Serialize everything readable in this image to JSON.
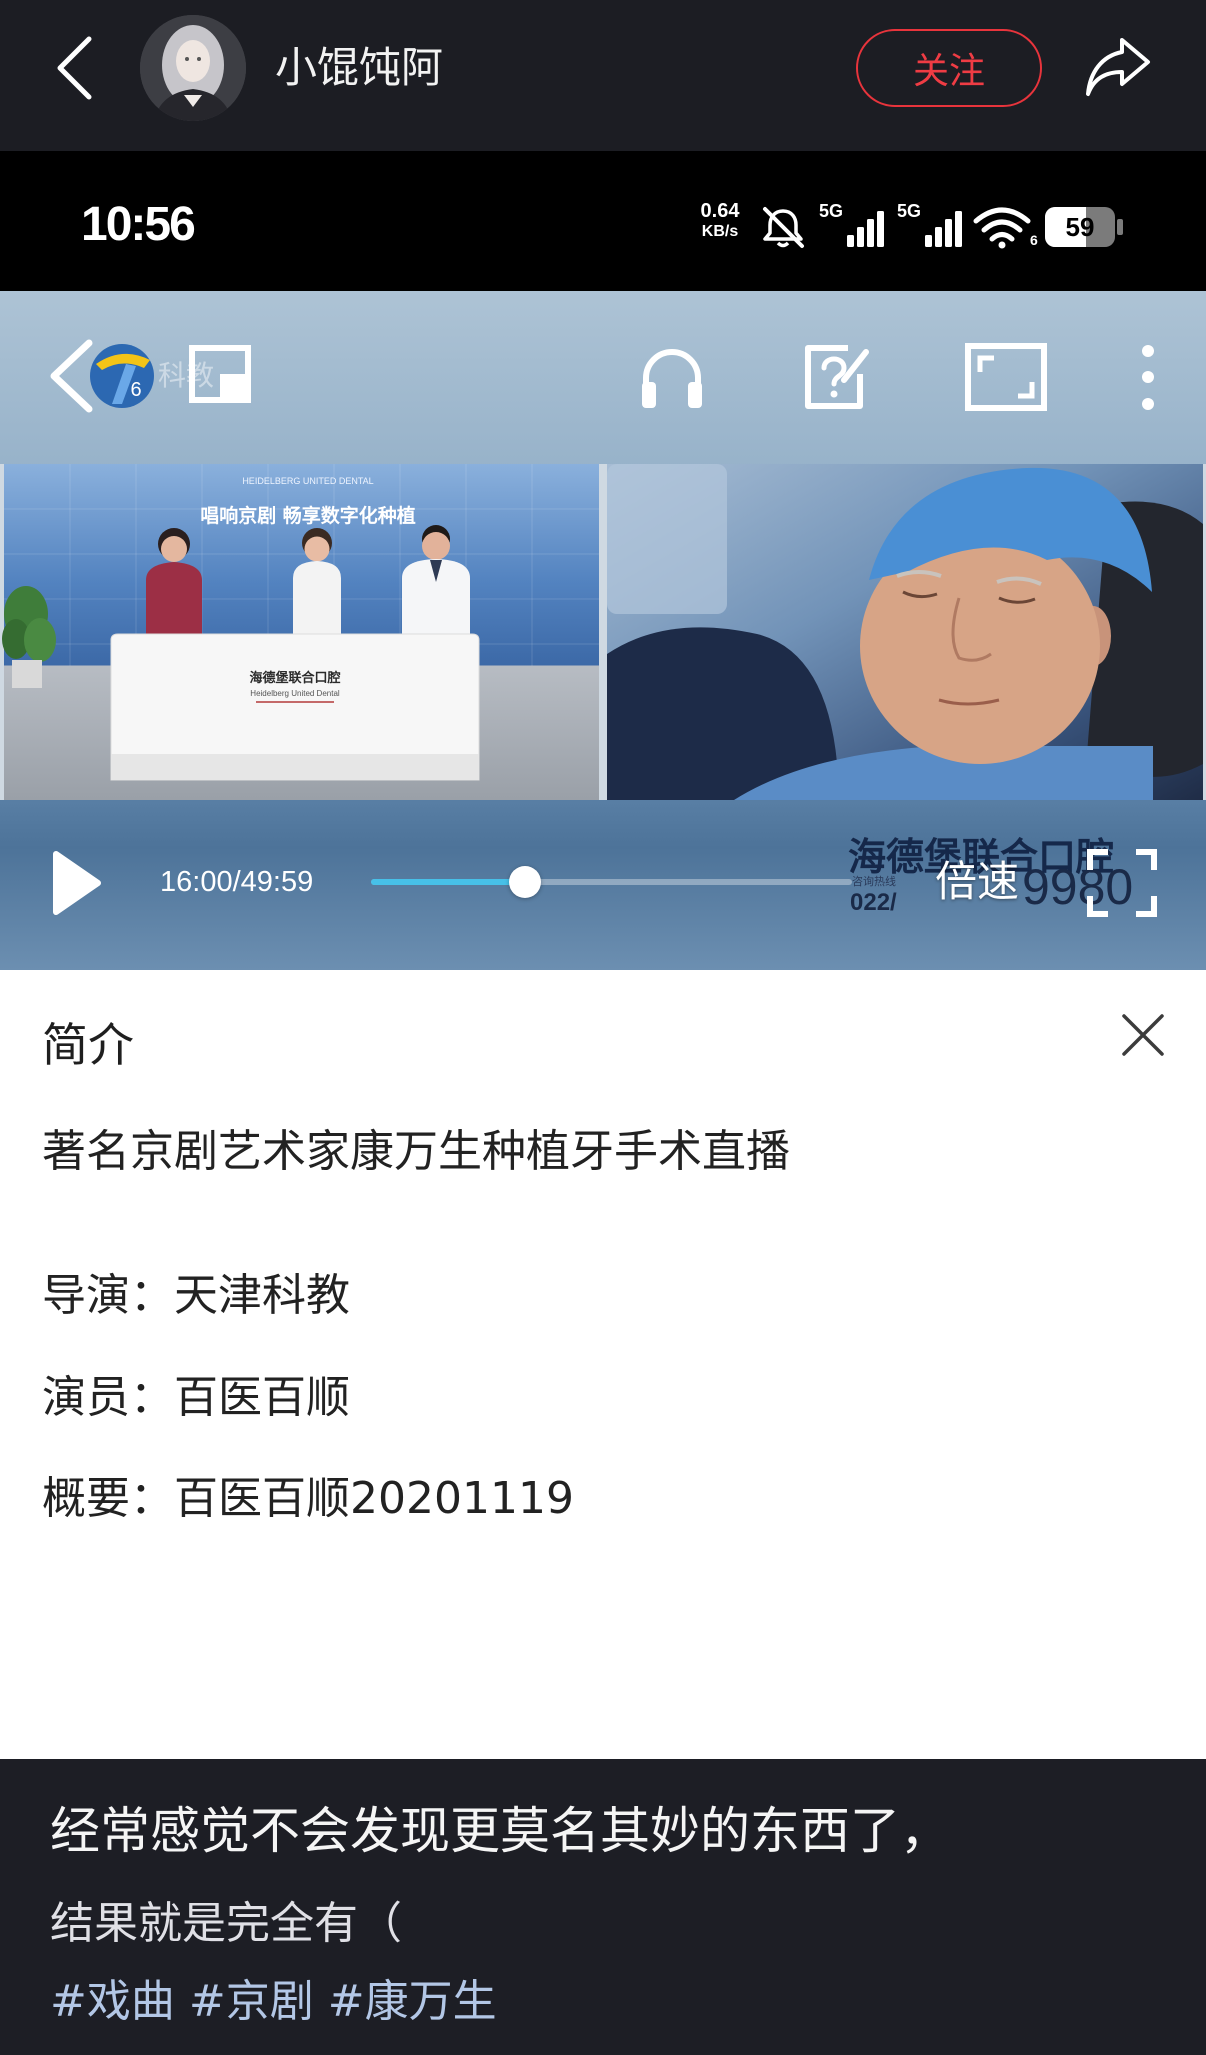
{
  "header": {
    "username": "小馄饨阿",
    "follow_label": "关注"
  },
  "status_bar": {
    "time": "10:56",
    "net_speed_value": "0.64",
    "net_speed_unit": "KB/s",
    "sim1_label": "5G",
    "sim2_label": "5G",
    "wifi_badge": "6",
    "battery_level": "59"
  },
  "player": {
    "channel_logo_digit": "6",
    "channel_name": "科教",
    "video_frame": {
      "banner_en": "HEIDELBERG UNITED DENTAL",
      "banner_title": "唱响京剧 畅享数字化种植",
      "desk_name_cn": "海德堡联合口腔",
      "desk_name_en": "Heidelberg United Dental"
    },
    "ad_overlay": {
      "title": "海德堡联合口腔",
      "hotline_label": "咨询热线",
      "phone_prefix": "022/",
      "phone_tail": "9980"
    },
    "time_display": "16:00/49:59",
    "progress_fraction": 0.32,
    "speed_label": "倍速"
  },
  "intro": {
    "title": "简介",
    "headline": "著名京剧艺术家康万生种植牙手术直播",
    "rows": [
      {
        "label": "导演：",
        "value": "天津科教"
      },
      {
        "label": "演员：",
        "value": "百医百顺"
      },
      {
        "label": "概要：",
        "value": "百医百顺20201119"
      }
    ]
  },
  "post": {
    "line1": "经常感觉不会发现更莫名其妙的东西了，",
    "line2": "结果就是完全有（",
    "tags": [
      "#戏曲",
      "#京剧",
      "#康万生"
    ]
  },
  "icons": {
    "header_back": "chevron-left-icon",
    "share": "share-icon",
    "mute": "bell-muted-icon",
    "signal": "signal-bars-icon",
    "wifi": "wifi-icon",
    "battery": "battery-icon",
    "video_back": "chevron-left-icon",
    "channel_logo": "channel-logo-icon",
    "pip": "picture-in-picture-icon",
    "audio_mode": "headphones-icon",
    "feedback": "question-edit-icon",
    "screen": "screen-icon",
    "more": "more-vertical-icon",
    "play": "play-icon",
    "fullscreen": "fullscreen-icon",
    "close": "close-icon"
  },
  "colors": {
    "accent": "#e8343c",
    "progress_fill": "#47c0e8",
    "hashtag": "#b3c7e6",
    "panel_background": "#ffffff",
    "dark_background": "#1d1e25"
  }
}
